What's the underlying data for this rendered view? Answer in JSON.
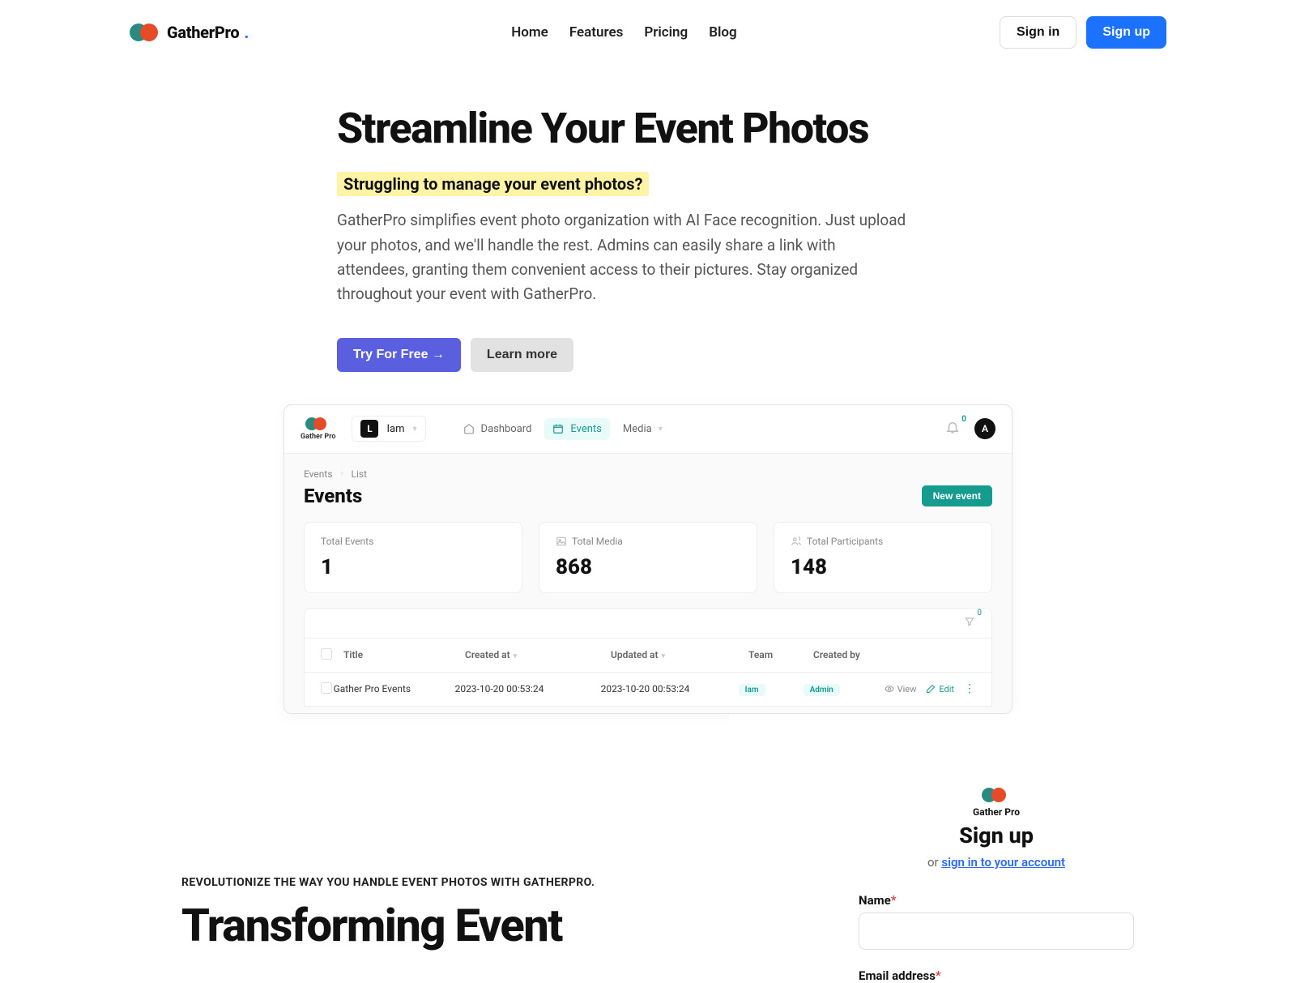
{
  "brand": "GatherPro",
  "nav": {
    "items": [
      "Home",
      "Features",
      "Pricing",
      "Blog"
    ],
    "signin": "Sign in",
    "signup": "Sign up"
  },
  "hero": {
    "headline": "Streamline Your Event Photos",
    "question": "Struggling to manage your event photos?",
    "desc": "GatherPro simplifies event photo organization with AI Face recognition. Just upload your photos, and we'll handle the rest. Admins can easily share a link with attendees, granting them convenient access to their pictures. Stay organized throughout your event with GatherPro.",
    "cta_primary": "Try For Free →",
    "cta_secondary": "Learn more"
  },
  "shot": {
    "brand": "Gather Pro",
    "org_letter": "L",
    "org_name": "Iam",
    "topnav": {
      "dashboard": "Dashboard",
      "events": "Events",
      "media": "Media"
    },
    "notif_count": "0",
    "avatar": "A",
    "breadcrumbs": [
      "Events",
      "List"
    ],
    "section_title": "Events",
    "new_event": "New event",
    "stats": [
      {
        "label": "Total Events",
        "value": "1"
      },
      {
        "label": "Total Media",
        "value": "868"
      },
      {
        "label": "Total Participants",
        "value": "148"
      }
    ],
    "filter_count": "0",
    "columns": {
      "title": "Title",
      "created": "Created at",
      "updated": "Updated at",
      "team": "Team",
      "by": "Created by"
    },
    "row": {
      "title": "Gather Pro Events",
      "created": "2023-10-20 00:53:24",
      "updated": "2023-10-20 00:53:24",
      "team": "Iam",
      "by": "Admin",
      "view": "View",
      "edit": "Edit"
    }
  },
  "features": {
    "overline": "REVOLUTIONIZE THE WAY YOU HANDLE EVENT PHOTOS WITH GATHERPRO.",
    "heading": "Transforming Event"
  },
  "signup": {
    "brand": "Gather Pro",
    "title": "Sign up",
    "or": "or ",
    "signin_link": "sign in to your account",
    "name_label": "Name",
    "email_label": "Email address"
  }
}
